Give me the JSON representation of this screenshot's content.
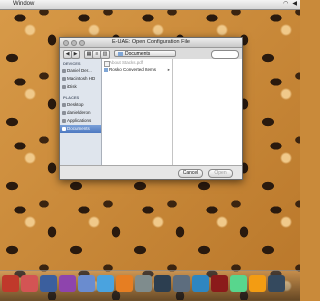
{
  "menubar": {
    "app_menu": "Window"
  },
  "dialog": {
    "title": "E-UAE: Open Configuration File",
    "path": "Documents",
    "sidebar": {
      "devices_header": "DEVICES",
      "devices": [
        "Daniel Der...",
        "Macintosh HD",
        "iDisk"
      ],
      "places_header": "PLACES",
      "places": [
        "Desktop",
        "danielderon",
        "Applications",
        "Documents"
      ],
      "selected": "Documents"
    },
    "files": [
      {
        "name": "About Stacks.pdf",
        "kind": "doc",
        "enabled": false
      },
      {
        "name": "Rosko Converted Items",
        "kind": "folder",
        "enabled": true
      }
    ],
    "cancel_label": "Cancel",
    "open_label": "Open"
  },
  "colors": {
    "selection": "#4d79c0",
    "sidebar_bg": "#dfe5ed",
    "wallpaper_base": "#c98a3a"
  }
}
